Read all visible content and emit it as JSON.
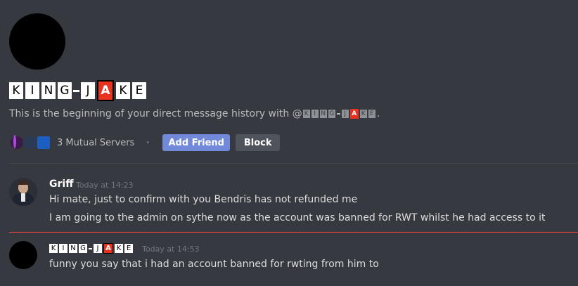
{
  "header": {
    "display_name_tiles": [
      "K",
      "I",
      "N",
      "G",
      "J",
      "A",
      "K",
      "E"
    ],
    "highlighted_letter": "A",
    "beginning_text": "This is the beginning of your direct message history with @",
    "beginning_text_end": "."
  },
  "profile_actions": {
    "mutual_servers_label": "3 Mutual Servers",
    "separator": "•",
    "add_friend_label": "Add Friend",
    "block_label": "Block"
  },
  "messages": [
    {
      "author": "Griff",
      "timestamp": "Today at 14:23",
      "lines": [
        "Hi mate, just to confirm with you Bendris has not refunded me",
        "I am going to the admin on sythe now as the account was banned for RWT whilst he had access to it"
      ]
    },
    {
      "author_tiles": [
        "K",
        "I",
        "N",
        "G",
        "J",
        "A",
        "K",
        "E"
      ],
      "timestamp": "Today at 14:53",
      "lines": [
        "funny you say that i had an account banned for rwting from him to"
      ]
    }
  ],
  "colors": {
    "background": "#36393f",
    "accent_blurple": "#7289da",
    "block_button": "#4f545c",
    "new_messages_line": "#f04747",
    "name_highlight": "#e8311f"
  }
}
